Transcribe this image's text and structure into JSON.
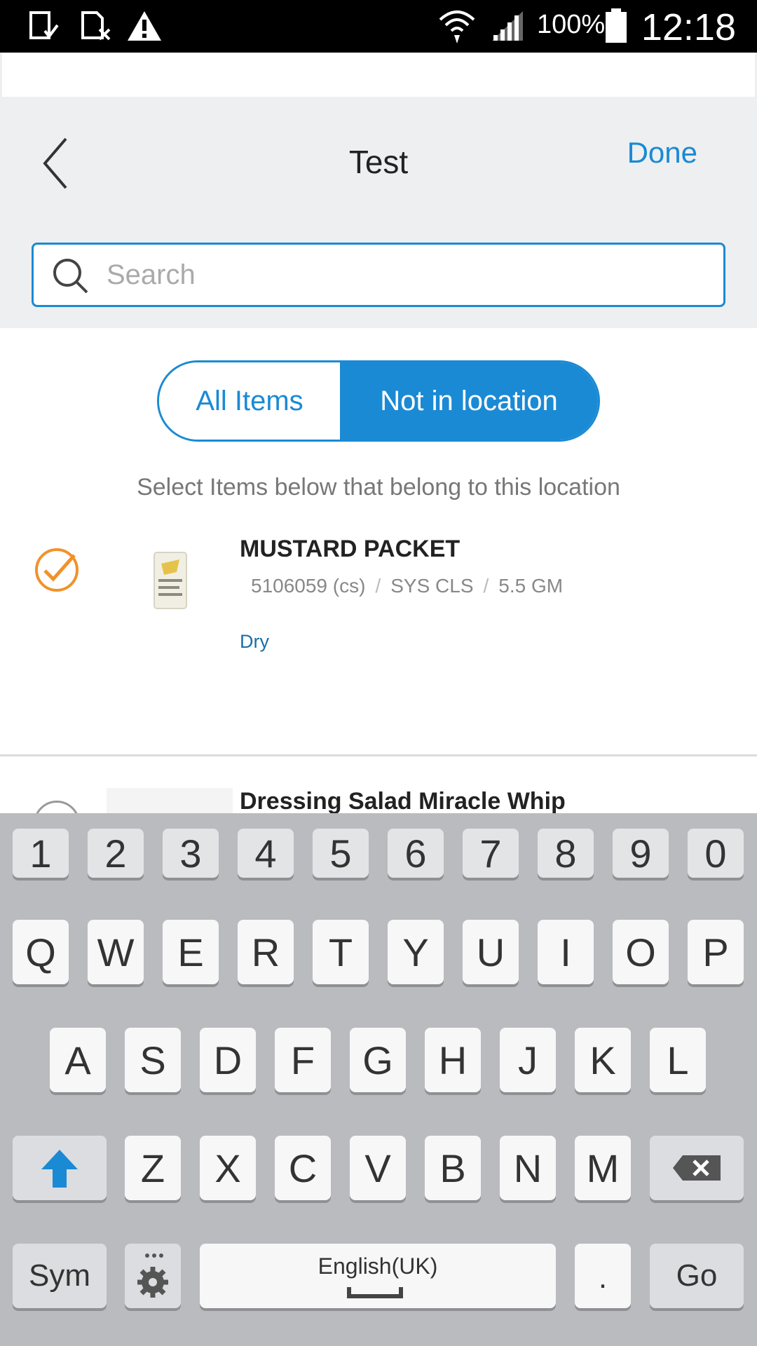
{
  "status_bar": {
    "battery": "100%",
    "time": "12:18"
  },
  "header": {
    "title": "Test",
    "done_label": "Done"
  },
  "search": {
    "placeholder": "Search",
    "value": ""
  },
  "segment": {
    "all_items": "All Items",
    "not_in_location": "Not in location",
    "selected": "Not in location"
  },
  "hint": "Select Items below that belong to this location",
  "items": [
    {
      "name": "MUSTARD PACKET",
      "code": "5106059 (cs)",
      "brand": "SYS CLS",
      "size": "5.5 GM",
      "tag": "Dry",
      "checked": true
    },
    {
      "name": "Dressing Salad Miracle Whip",
      "checked": false
    }
  ],
  "colors": {
    "accent": "#1a8ad4",
    "check": "#f0922b"
  },
  "keyboard": {
    "row_numbers": [
      "1",
      "2",
      "3",
      "4",
      "5",
      "6",
      "7",
      "8",
      "9",
      "0"
    ],
    "row1": [
      "Q",
      "W",
      "E",
      "R",
      "T",
      "Y",
      "U",
      "I",
      "O",
      "P"
    ],
    "row2": [
      "A",
      "S",
      "D",
      "F",
      "G",
      "H",
      "J",
      "K",
      "L"
    ],
    "row3": [
      "Z",
      "X",
      "C",
      "V",
      "B",
      "N",
      "M"
    ],
    "sym": "Sym",
    "space": "English(UK)",
    "period": ".",
    "go": "Go"
  }
}
